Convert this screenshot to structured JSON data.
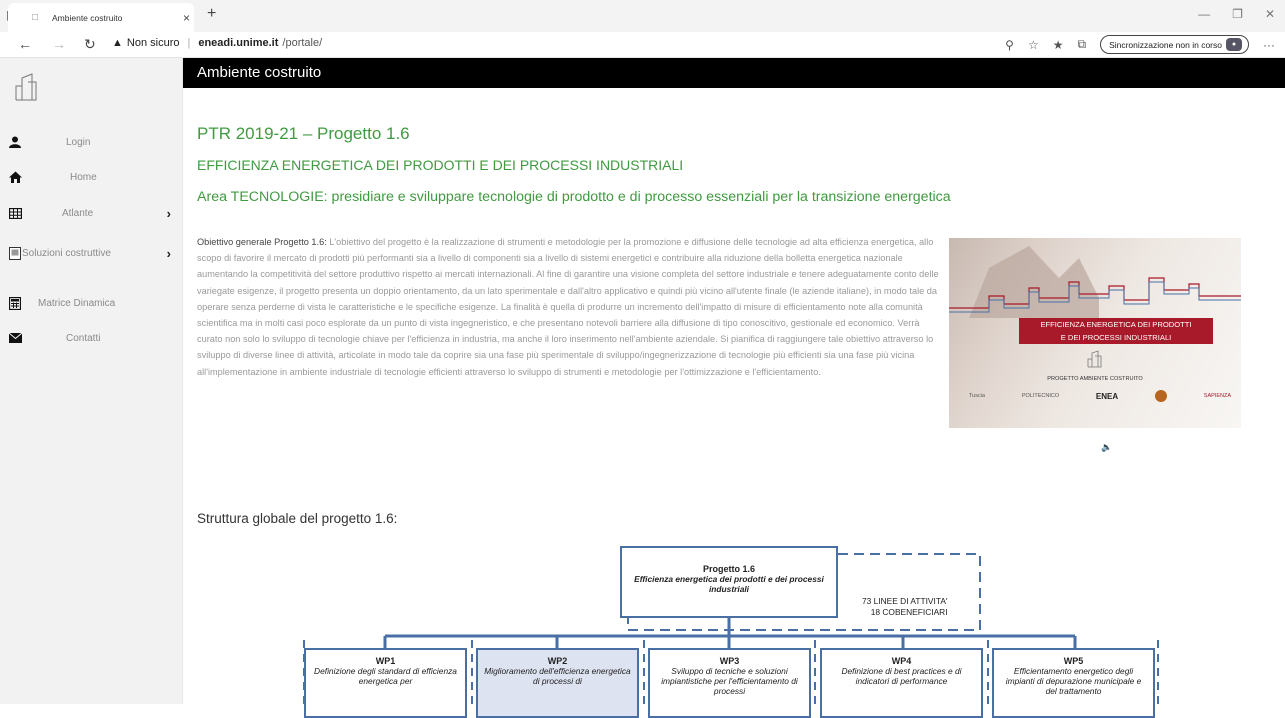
{
  "browser": {
    "tab_title": "Ambiente costruito",
    "tab_close": "×",
    "new_tab": "+",
    "not_secure": "Non sicuro",
    "url_host": "eneadi.unime.it",
    "url_path": "/portale/",
    "sync_label": "Sincronizzazione non in corso",
    "more": "···"
  },
  "sidebar": {
    "items": [
      {
        "label": "Login",
        "icon": "user-icon",
        "has_submenu": false
      },
      {
        "label": "Home",
        "icon": "home-icon",
        "has_submenu": false
      },
      {
        "label": "Atlante",
        "icon": "table-icon",
        "has_submenu": true
      },
      {
        "label": "Soluzioni costruttive",
        "icon": "building-icon",
        "has_submenu": true
      },
      {
        "label": "Matrice Dinamica",
        "icon": "calculator-icon",
        "has_submenu": false
      },
      {
        "label": "Contatti",
        "icon": "envelope-icon",
        "has_submenu": false
      }
    ],
    "chevron": "›"
  },
  "header": {
    "title": "Ambiente costruito"
  },
  "content": {
    "title": "PTR 2019-21 – Progetto 1.6",
    "subtitle": "EFFICIENZA ENERGETICA DEI PRODOTTI E DEI PROCESSI INDUSTRIALI",
    "area": "Area TECNOLOGIE: presidiare e sviluppare tecnologie di prodotto e di processo essenziali per la transizione energetica",
    "objective_label": "Obiettivo generale Progetto 1.6:",
    "objective_text": " L'obiettivo del progetto è la realizzazione di strumenti e metodologie per la promozione e diffusione delle tecnologie ad alta efficienza energetica, allo scopo di favorire il mercato di prodotti più performanti sia a livello di componenti sia a livello di sistemi energetici e contribuire alla riduzione della bolletta energetica nazionale aumentando la competitività del settore produttivo rispetto ai mercati internazionali. Al fine di garantire una visione completa del settore industriale e tenere adeguatamente conto delle variegate esigenze, il progetto presenta un doppio orientamento, da un lato sperimentale e dall'altro applicativo e quindi più vicino all'utente finale (le aziende italiane), in modo tale da operare senza perderne di vista le caratteristiche e le specifiche esigenze. La finalità è quella di produrre un incremento dell'impatto di misure di efficientamento note alla comunità scientifica ma in molti casi poco esplorate da un punto di vista ingegneristico, e che presentano notevoli barriere alla diffusione di tipo conoscitivo, gestionale ed economico. Verrà curato non solo lo sviluppo di tecnologie chiave per l'efficienza in industria, ma anche il loro inserimento nell'ambiente aziendale. Si pianifica di raggiungere tale obiettivo attraverso lo sviluppo di diverse linee di attività, articolate in modo tale da coprire sia una fase più sperimentale di sviluppo/ingegnerizzazione di tecnologie più efficienti sia una fase più vicina all'implementazione in ambiente industriale di tecnologie efficienti attraverso lo sviluppo di strumenti e metodologie per l'ottimizzazione e l'efficientamento.",
    "structure_title": "Struttura globale del progetto 1.6:"
  },
  "image": {
    "label_line1": "EFFICIENZA ENERGETICA DEI PRODOTTI",
    "label_line2": "E DEI PROCESSI INDUSTRIALI",
    "caption": "PROGETTO AMBIENTE COSTRUITO",
    "partners": [
      "Tuscia",
      "POLITECNICO",
      "ENEA",
      "",
      "SAPIENZA"
    ]
  },
  "diagram": {
    "project": {
      "title": "Progetto 1.6",
      "subtitle": "Efficienza energetica dei prodotti e dei processi industriali"
    },
    "stats_line1": "73 LINEE DI ATTIVITA'",
    "stats_line2": "18 COBENEFICIARI",
    "wps": [
      {
        "title": "WP1",
        "desc": "Definizione degli standard di efficienza energetica per"
      },
      {
        "title": "WP2",
        "desc": "Miglioramento dell'efficienza energetica di processi di"
      },
      {
        "title": "WP3",
        "desc": "Sviluppo di tecniche e soluzioni impiantistiche per l'efficientamento di processi"
      },
      {
        "title": "WP4",
        "desc": "Definizione di best practices e di indicatori di performance"
      },
      {
        "title": "WP5",
        "desc": "Efficientamento energetico degli impianti di depurazione municipale e del trattamento"
      }
    ]
  }
}
